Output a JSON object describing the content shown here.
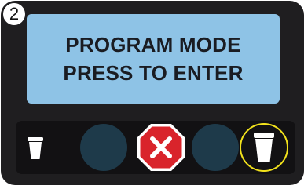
{
  "step": {
    "number": "2"
  },
  "display": {
    "line1": "PROGRAM MODE",
    "line2": "PRESS TO ENTER"
  },
  "buttons": [
    {
      "name": "small-cup-button",
      "icon": "small-cup-icon"
    },
    {
      "name": "blank-button-left",
      "icon": ""
    },
    {
      "name": "stop-button",
      "icon": "x-icon"
    },
    {
      "name": "blank-button-right",
      "icon": ""
    },
    {
      "name": "large-cup-button",
      "icon": "large-cup-icon",
      "highlighted": true
    }
  ],
  "colors": {
    "panel": "#1f1e20",
    "screen": "#8ec3e6",
    "stop_red": "#d9242b",
    "highlight_ring": "#f2e21c",
    "button_dark": "#1e3a4a"
  }
}
